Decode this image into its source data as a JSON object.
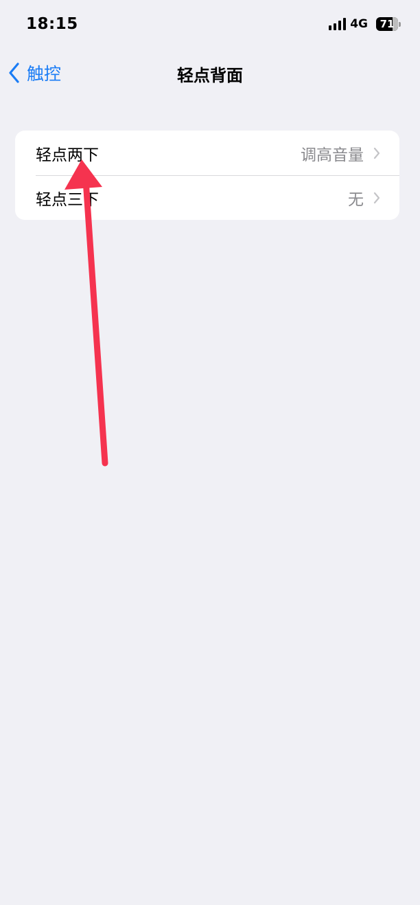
{
  "status_bar": {
    "time": "18:15",
    "network": "4G",
    "battery_level": "71",
    "icons": [
      "signal-bars-icon",
      "battery-icon"
    ]
  },
  "nav": {
    "back_label": "触控",
    "title": "轻点背面",
    "back_icon": "chevron-left-icon"
  },
  "rows": [
    {
      "label": "轻点两下",
      "value": "调高音量",
      "icon": "chevron-right-icon"
    },
    {
      "label": "轻点三下",
      "value": "无",
      "icon": "chevron-right-icon"
    }
  ],
  "annotation": {
    "type": "arrow",
    "color": "#f5334f",
    "points_to": "轻点两下"
  },
  "colors": {
    "background": "#f0f0f5",
    "accent": "#1a7cf5",
    "secondary_text": "#8a8a8e"
  }
}
